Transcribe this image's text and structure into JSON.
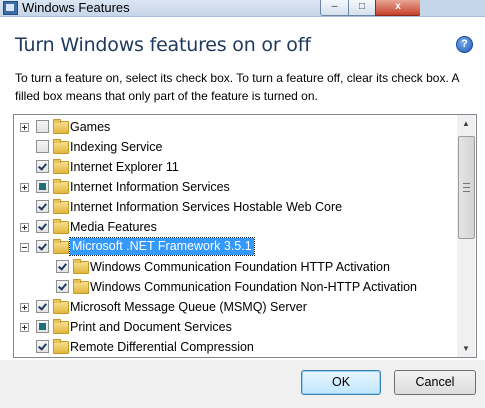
{
  "window": {
    "title": "Windows Features",
    "minimize_glyph": "–",
    "maximize_glyph": "□",
    "close_glyph": "x"
  },
  "header": {
    "heading": "Turn Windows features on or off",
    "help_glyph": "?",
    "description": "To turn a feature on, select its check box. To turn a feature off, clear its check box. A filled box means that only part of the feature is turned on."
  },
  "features": [
    {
      "label": "Games",
      "state": "unchecked",
      "expander": "plus",
      "level": 0
    },
    {
      "label": "Indexing Service",
      "state": "unchecked",
      "expander": "none",
      "level": 0
    },
    {
      "label": "Internet Explorer 11",
      "state": "checked",
      "expander": "none",
      "level": 0
    },
    {
      "label": "Internet Information Services",
      "state": "partial",
      "expander": "plus",
      "level": 0
    },
    {
      "label": "Internet Information Services Hostable Web Core",
      "state": "checked",
      "expander": "none",
      "level": 0
    },
    {
      "label": "Media Features",
      "state": "checked",
      "expander": "plus",
      "level": 0
    },
    {
      "label": "Microsoft .NET Framework 3.5.1",
      "state": "checked",
      "expander": "minus",
      "level": 0,
      "selected": true
    },
    {
      "label": "Windows Communication Foundation HTTP Activation",
      "state": "checked",
      "expander": "none",
      "level": 1
    },
    {
      "label": "Windows Communication Foundation Non-HTTP Activation",
      "state": "checked",
      "expander": "none",
      "level": 1
    },
    {
      "label": "Microsoft Message Queue (MSMQ) Server",
      "state": "checked",
      "expander": "plus",
      "level": 0
    },
    {
      "label": "Print and Document Services",
      "state": "partial",
      "expander": "plus",
      "level": 0
    },
    {
      "label": "Remote Differential Compression",
      "state": "checked",
      "expander": "none",
      "level": 0
    }
  ],
  "scrollbar": {
    "up_glyph": "▲",
    "down_glyph": "▼"
  },
  "buttons": {
    "ok": "OK",
    "cancel": "Cancel"
  },
  "icons": {
    "app": "windows-features-icon",
    "help": "help-icon",
    "folder": "folder-icon"
  },
  "colors": {
    "heading": "#1e395b",
    "selection": "#3399ff",
    "partial_fill": "#1e6f7a"
  }
}
